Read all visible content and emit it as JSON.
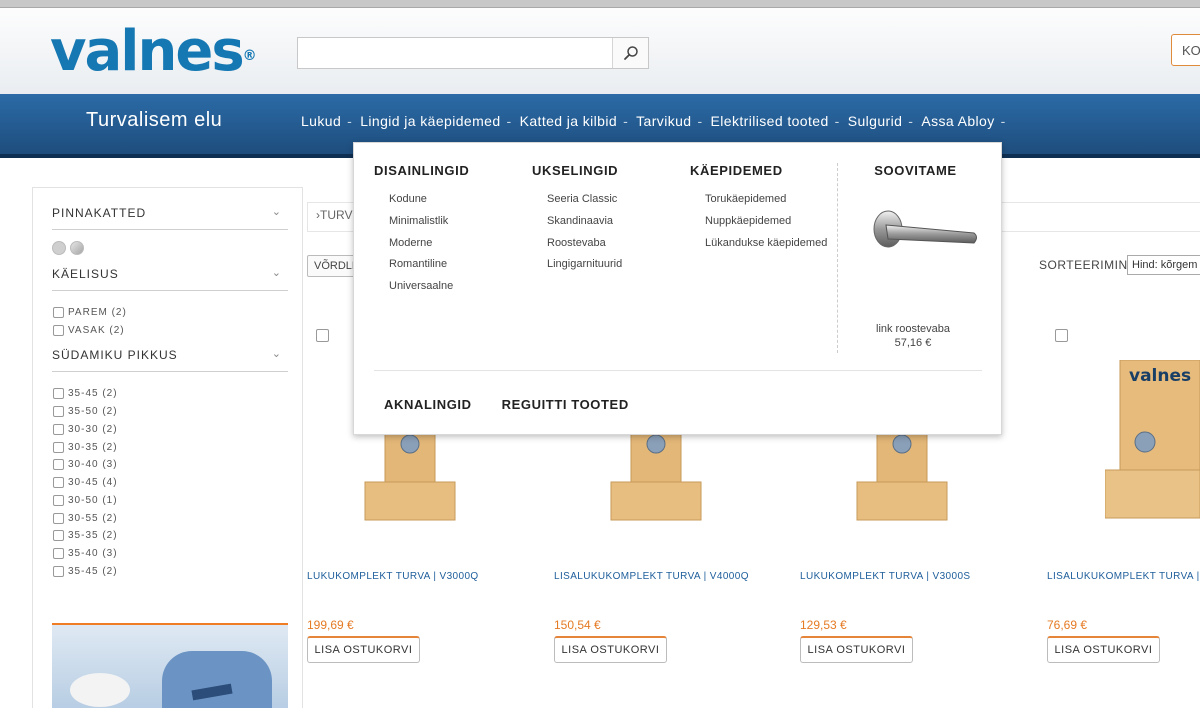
{
  "header": {
    "logo_text": "valnes",
    "logo_mark": "®",
    "search": {
      "value": "",
      "placeholder": "",
      "icon": "search-icon"
    },
    "cart_label": "KO"
  },
  "nav": {
    "tagline": "Turvalisem elu",
    "items": [
      {
        "label": "Lukud",
        "sep": "-"
      },
      {
        "label": "Lingid ja käepidemed",
        "sep": "-"
      },
      {
        "label": "Katted ja kilbid",
        "sep": "-"
      },
      {
        "label": "Tarvikud",
        "sep": "-"
      },
      {
        "label": "Elektrilised tooted",
        "sep": "-"
      },
      {
        "label": "Sulgurid",
        "sep": "-"
      },
      {
        "label": "Assa Abloy",
        "sep": "-"
      }
    ]
  },
  "megamenu": {
    "columns": [
      {
        "title": "DISAINLINGID",
        "items": [
          "Kodune",
          "Minimalistlik",
          "Moderne",
          "Romantiline",
          "Universaalne"
        ]
      },
      {
        "title": "UKSELINGID",
        "items": [
          "Seeria Classic",
          "Skandinaavia",
          "Roostevaba",
          "Lingigarnituurid"
        ]
      },
      {
        "title": "KÄEPIDEMED",
        "items": [
          "Torukäepidemed",
          "Nuppkäepidemed",
          "Lükandukse käepidemed"
        ]
      }
    ],
    "recommend": {
      "title": "SOOVITAME",
      "product_name": "link roostevaba",
      "price": "57,16 €"
    },
    "bottom_links": [
      "AKNALINGID",
      "REGUITTI TOOTED"
    ]
  },
  "sidebar": {
    "filters": [
      {
        "title": "PINNAKATTED"
      },
      {
        "title": "KÄELISUS",
        "options": [
          "PAREM (2)",
          "VASAK (2)"
        ]
      },
      {
        "title": "SÜDAMIKU PIKKUS",
        "options": [
          "35-45 (2)",
          "35-50 (2)",
          "30-30 (2)",
          "30-35 (2)",
          "30-40 (3)",
          "30-45 (4)",
          "30-50 (1)",
          "30-55 (2)",
          "35-35 (2)",
          "35-40 (3)",
          "35-45 (2)"
        ]
      }
    ]
  },
  "toolbar": {
    "breadcrumb": "TURV",
    "compare_label": "VÕRDLE",
    "sort_label": "SORTEERIMINE:",
    "sort_value": "Hind: kõrgem"
  },
  "products": [
    {
      "title": "LUKUKOMPLEKT TURVA | V3000Q",
      "price": "199,69 €",
      "button": "LISA OSTUKORVI"
    },
    {
      "title": "LISALUKUKOMPLEKT TURVA | V4000Q",
      "price": "150,54 €",
      "button": "LISA OSTUKORVI"
    },
    {
      "title": "LUKUKOMPLEKT TURVA | V3000S",
      "price": "129,53 €",
      "button": "LISA OSTUKORVI"
    },
    {
      "title": "LISALUKUKOMPLEKT TURVA | V",
      "price": "76,69 €",
      "button": "LISA OSTUKORVI",
      "brand_label": "valnes"
    }
  ],
  "colors": {
    "brand_blue": "#1678b3",
    "nav_blue": "#245d94",
    "accent_orange": "#e57a24",
    "link_blue": "#1e5e9b"
  }
}
